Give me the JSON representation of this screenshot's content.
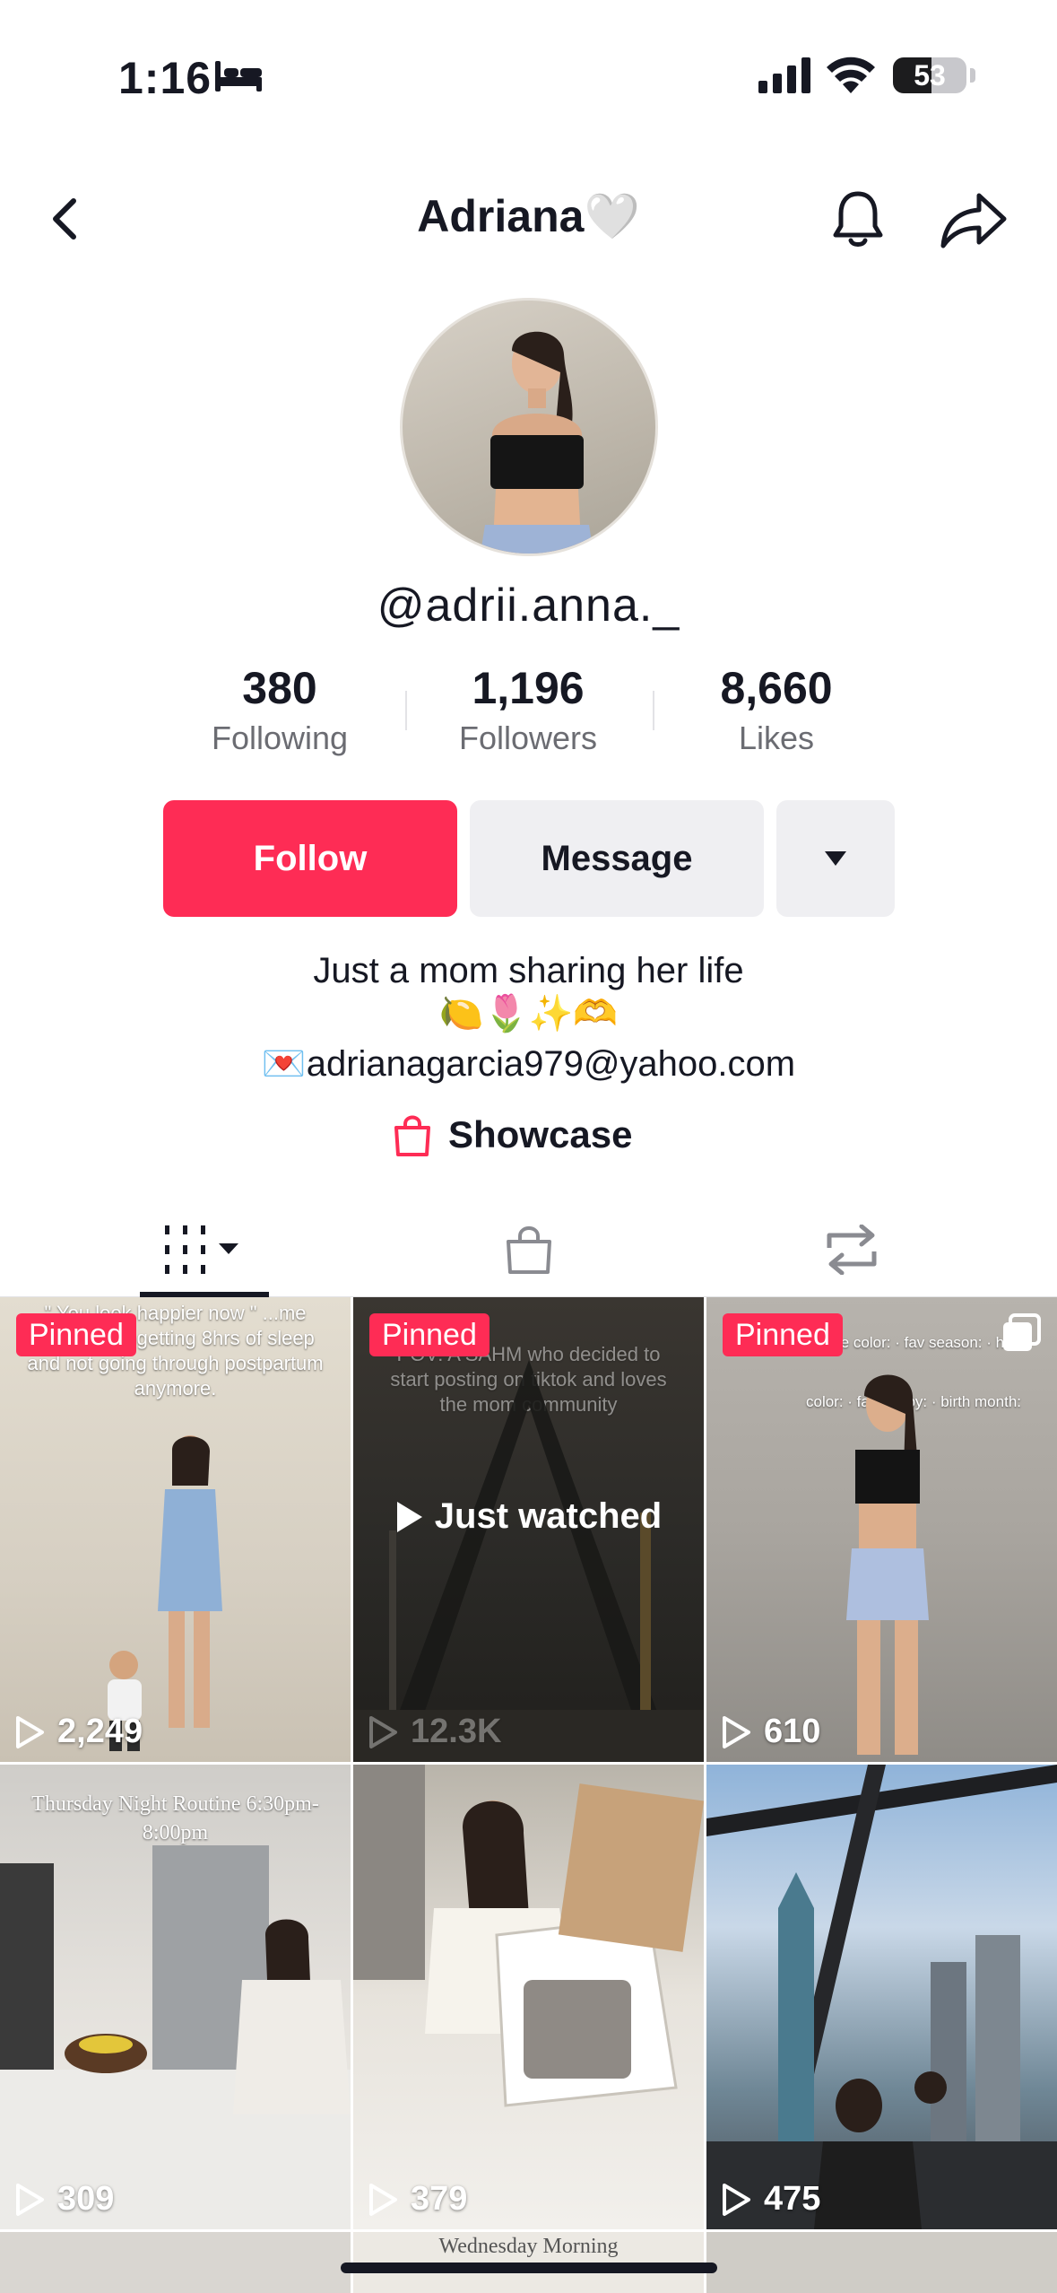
{
  "status_bar": {
    "time": "1:16",
    "battery": "53",
    "battery_level": 0.53
  },
  "header": {
    "title": "Adriana🤍"
  },
  "profile": {
    "username": "@adrii.anna._",
    "stats": [
      {
        "number": "380",
        "label": "Following"
      },
      {
        "number": "1,196",
        "label": "Followers"
      },
      {
        "number": "8,660",
        "label": "Likes"
      }
    ],
    "follow_label": "Follow",
    "message_label": "Message",
    "bio_line1": "Just a mom sharing her life",
    "bio_line2": "🍋🌷✨🫶",
    "bio_line3": "💌adrianagarcia979@yahoo.com",
    "showcase_label": "Showcase"
  },
  "videos": [
    {
      "pinned": "Pinned",
      "views": "2,249",
      "caption": "\" You look happier now \" ...me from finally getting 8hrs of sleep and not going through postpartum anymore."
    },
    {
      "pinned": "Pinned",
      "views": "12.3K",
      "status": "Just watched",
      "caption": "POV: A SAHM who decided to start posting on tiktok and loves the mom community"
    },
    {
      "pinned": "Pinned",
      "views": "610",
      "caption": "eye color: · fav season: · hair color: · fav hobby: · birth month:"
    },
    {
      "views": "309",
      "caption": "Thursday Night Routine 6:30pm-8:00pm"
    },
    {
      "views": "379"
    },
    {
      "views": "475"
    },
    {
      "caption": "Wednesday Morning"
    }
  ],
  "colors": {
    "accent": "#fe2c55",
    "text": "#161823",
    "secondary_text": "#6b6c72",
    "button_grey": "#efeff2"
  }
}
